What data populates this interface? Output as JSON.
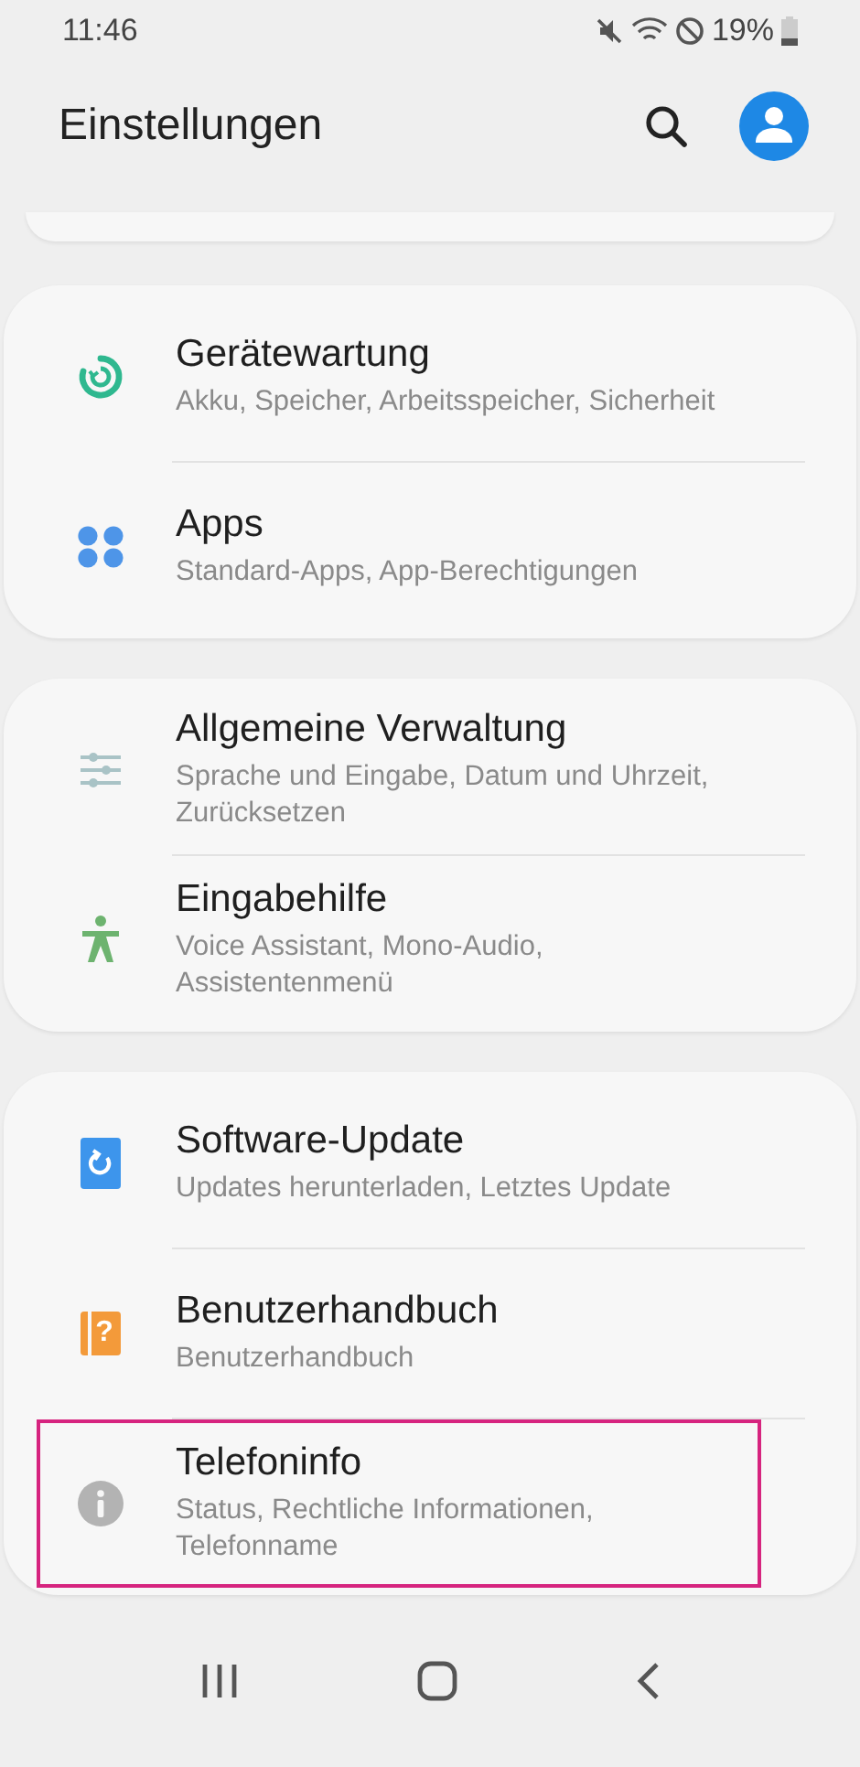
{
  "status_bar": {
    "time": "11:46",
    "battery": "19%"
  },
  "header": {
    "title": "Einstellungen"
  },
  "groups": [
    {
      "items": [
        {
          "kind": "maintenance",
          "title": "Gerätewartung",
          "subtitle": "Akku, Speicher, Arbeitsspeicher, Sicherheit",
          "selected": false
        },
        {
          "kind": "apps",
          "title": "Apps",
          "subtitle": "Standard-Apps, App-Berechtigungen",
          "selected": false
        }
      ]
    },
    {
      "items": [
        {
          "kind": "sliders",
          "title": "Allgemeine Verwaltung",
          "subtitle": "Sprache und Eingabe, Datum und Uhrzeit, Zurücksetzen",
          "selected": false
        },
        {
          "kind": "accessibility",
          "title": "Eingabehilfe",
          "subtitle": "Voice Assistant, Mono-Audio, Assistentenmenü",
          "selected": false
        }
      ]
    },
    {
      "items": [
        {
          "kind": "update",
          "title": "Software-Update",
          "subtitle": "Updates herunterladen, Letztes Update",
          "selected": false
        },
        {
          "kind": "manual",
          "icon_text": "?",
          "title": "Benutzerhandbuch",
          "subtitle": "Benutzerhandbuch",
          "selected": false
        },
        {
          "kind": "info",
          "title": "Telefoninfo",
          "subtitle": "Status, Rechtliche Informationen, Telefonname",
          "selected": true
        }
      ]
    }
  ]
}
